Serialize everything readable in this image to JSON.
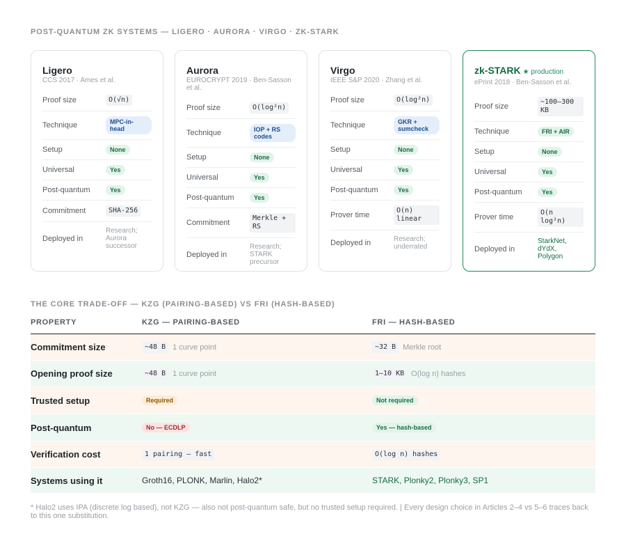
{
  "heading_systems": "POST-QUANTUM ZK SYSTEMS — LIGERO · AURORA · VIRGO · ZK-STARK",
  "heading_tradeoff": "THE CORE TRADE-OFF — KZG (PAIRING-BASED) VS FRI (HASH-BASED)",
  "cards": [
    {
      "name": "Ligero",
      "tag": "",
      "sub": "CCS 2017 · Ames et al.",
      "rows": [
        {
          "label": "Proof size",
          "value": "O(√n)",
          "kind": "mono"
        },
        {
          "label": "Technique",
          "value": "MPC-in-head",
          "kind": "blue"
        },
        {
          "label": "Setup",
          "value": "None",
          "kind": "green"
        },
        {
          "label": "Universal",
          "value": "Yes",
          "kind": "green"
        },
        {
          "label": "Post-quantum",
          "value": "Yes",
          "kind": "green"
        },
        {
          "label": "Commitment",
          "value": "SHA-256",
          "kind": "mono"
        },
        {
          "label": "Deployed in",
          "value": "Research; Aurora successor",
          "kind": "muted"
        }
      ]
    },
    {
      "name": "Aurora",
      "tag": "",
      "sub": "EUROCRYPT 2019 · Ben-Sasson et al.",
      "rows": [
        {
          "label": "Proof size",
          "value": "O(log²n)",
          "kind": "mono"
        },
        {
          "label": "Technique",
          "value": "IOP + RS codes",
          "kind": "blue"
        },
        {
          "label": "Setup",
          "value": "None",
          "kind": "green"
        },
        {
          "label": "Universal",
          "value": "Yes",
          "kind": "green"
        },
        {
          "label": "Post-quantum",
          "value": "Yes",
          "kind": "green"
        },
        {
          "label": "Commitment",
          "value": "Merkle + RS",
          "kind": "mono"
        },
        {
          "label": "Deployed in",
          "value": "Research; STARK precursor",
          "kind": "muted"
        }
      ]
    },
    {
      "name": "Virgo",
      "tag": "",
      "sub": "IEEE S&P 2020 · Zhang et al.",
      "rows": [
        {
          "label": "Proof size",
          "value": "O(log²n)",
          "kind": "mono"
        },
        {
          "label": "Technique",
          "value": "GKR + sumcheck",
          "kind": "blue"
        },
        {
          "label": "Setup",
          "value": "None",
          "kind": "green"
        },
        {
          "label": "Universal",
          "value": "Yes",
          "kind": "green"
        },
        {
          "label": "Post-quantum",
          "value": "Yes",
          "kind": "green"
        },
        {
          "label": "Prover time",
          "value": "O(n) linear",
          "kind": "mono"
        },
        {
          "label": "Deployed in",
          "value": "Research; underrated",
          "kind": "muted"
        }
      ]
    },
    {
      "name": "zk-STARK",
      "tag": "★ production",
      "sub": "ePrint 2018 · Ben-Sasson et al.",
      "rows": [
        {
          "label": "Proof size",
          "value": "~100–300 KB",
          "kind": "mono"
        },
        {
          "label": "Technique",
          "value": "FRI + AIR",
          "kind": "green"
        },
        {
          "label": "Setup",
          "value": "None",
          "kind": "green"
        },
        {
          "label": "Universal",
          "value": "Yes",
          "kind": "green"
        },
        {
          "label": "Post-quantum",
          "value": "Yes",
          "kind": "green"
        },
        {
          "label": "Prover time",
          "value": "O(n log²n)",
          "kind": "mono"
        },
        {
          "label": "Deployed in",
          "value": "StarkNet, dYdX, Polygon",
          "kind": "greentext"
        }
      ]
    }
  ],
  "table": {
    "headers": [
      "PROPERTY",
      "KZG — PAIRING-BASED",
      "FRI — HASH-BASED"
    ],
    "rows": [
      {
        "property": "Commitment size",
        "kzg": {
          "value": "~48 B",
          "kind": "mono",
          "note": "1 curve point"
        },
        "fri": {
          "value": "~32 B",
          "kind": "mono",
          "note": "Merkle root"
        }
      },
      {
        "property": "Opening proof size",
        "kzg": {
          "value": "~48 B",
          "kind": "mono",
          "note": "1 curve point"
        },
        "fri": {
          "value": "1–10 KB",
          "kind": "mono",
          "note": "O(log n) hashes"
        }
      },
      {
        "property": "Trusted setup",
        "kzg": {
          "value": "Required",
          "kind": "amber",
          "note": ""
        },
        "fri": {
          "value": "Not required",
          "kind": "green",
          "note": ""
        }
      },
      {
        "property": "Post-quantum",
        "kzg": {
          "value": "No — ECDLP",
          "kind": "red",
          "note": ""
        },
        "fri": {
          "value": "Yes — hash-based",
          "kind": "green",
          "note": ""
        }
      },
      {
        "property": "Verification cost",
        "kzg": {
          "value": "1 pairing — fast",
          "kind": "mono",
          "note": ""
        },
        "fri": {
          "value": "O(log n) hashes",
          "kind": "mono",
          "note": ""
        }
      },
      {
        "property": "Systems using it",
        "kzg": {
          "value": "Groth16, PLONK, Marlin, Halo2*",
          "kind": "plainkzg",
          "note": ""
        },
        "fri": {
          "value": "STARK, Plonky2, Plonky3, SP1",
          "kind": "plainfri",
          "note": ""
        }
      }
    ]
  },
  "footnote": "* Halo2 uses IPA (discrete log based), not KZG — also not post-quantum safe, but no trusted setup required.  |  Every design choice in Articles 2–4 vs 5–6 traces back to this one substitution."
}
